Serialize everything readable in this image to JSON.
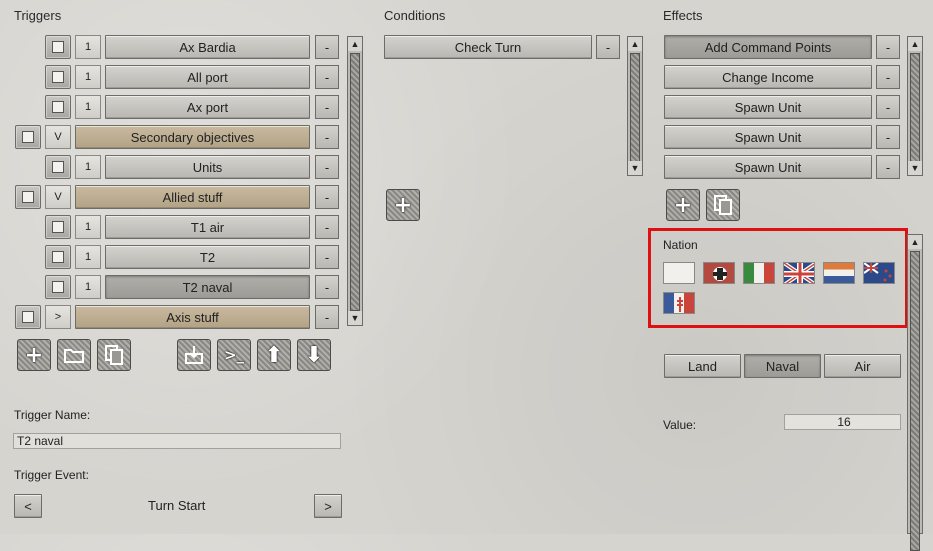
{
  "triggers": {
    "title": "Triggers",
    "rows": [
      {
        "toggle": "1",
        "label": "Ax Bardia",
        "remove": "-"
      },
      {
        "toggle": "1",
        "label": "All port",
        "remove": "-"
      },
      {
        "toggle": "1",
        "label": "Ax port",
        "remove": "-"
      },
      {
        "toggle": "V",
        "label": "Secondary objectives",
        "remove": "-"
      },
      {
        "toggle": "1",
        "label": "Units",
        "remove": "-"
      },
      {
        "toggle": "V",
        "label": "Allied stuff",
        "remove": "-"
      },
      {
        "toggle": "1",
        "label": "T1 air",
        "remove": "-"
      },
      {
        "toggle": "1",
        "label": "T2",
        "remove": "-"
      },
      {
        "toggle": "1",
        "label": "T2 naval",
        "remove": "-"
      },
      {
        "toggle": ">",
        "label": "Axis stuff",
        "remove": "-"
      }
    ],
    "name_label": "Trigger Name:",
    "name_value": "T2 naval",
    "event_label": "Trigger Event:",
    "event_value": "Turn Start",
    "prev": "<",
    "next": ">"
  },
  "conditions": {
    "title": "Conditions",
    "rows": [
      {
        "label": "Check Turn",
        "remove": "-"
      }
    ]
  },
  "effects": {
    "title": "Effects",
    "rows": [
      {
        "label": "Add Command Points",
        "remove": "-"
      },
      {
        "label": "Change Income",
        "remove": "-"
      },
      {
        "label": "Spawn Unit",
        "remove": "-"
      },
      {
        "label": "Spawn Unit",
        "remove": "-"
      },
      {
        "label": "Spawn Unit",
        "remove": "-"
      }
    ],
    "nation_label": "Nation",
    "tabs": [
      "Land",
      "Naval",
      "Air"
    ],
    "selected_tab": "Naval",
    "value_label": "Value:",
    "value": "16"
  },
  "icons": {
    "add": "+",
    "terminal": ">_",
    "up": "⬆",
    "down": "⬇"
  }
}
